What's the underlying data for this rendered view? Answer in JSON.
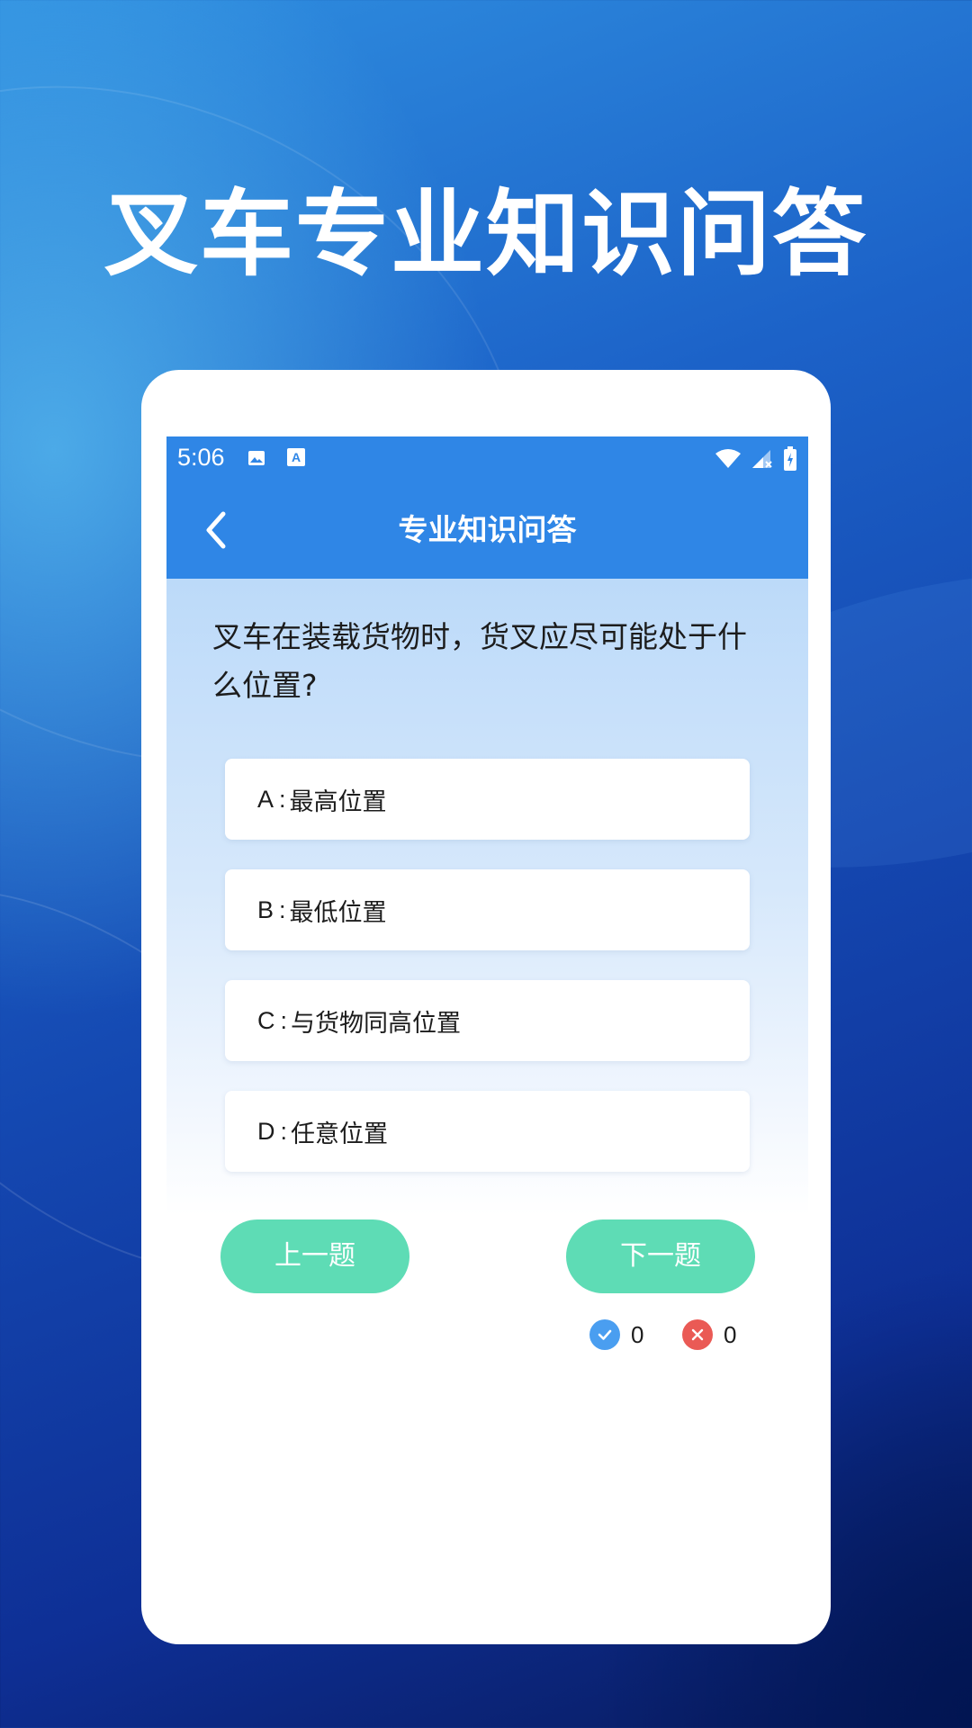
{
  "promo": {
    "headline": "叉车专业知识问答"
  },
  "status_bar": {
    "time": "5:06",
    "icons": [
      "image-icon",
      "text-a-icon",
      "wifi-icon",
      "signal-icon",
      "battery-icon"
    ]
  },
  "app_bar": {
    "title": "专业知识问答",
    "back_icon": "chevron-left-icon"
  },
  "quiz": {
    "question": "叉车在装载货物时，货叉应尽可能处于什么位置?",
    "options": [
      {
        "letter": "A",
        "sep": ":",
        "text": "最高位置"
      },
      {
        "letter": "B",
        "sep": ":",
        "text": "最低位置"
      },
      {
        "letter": "C",
        "sep": ":",
        "text": "与货物同高位置"
      },
      {
        "letter": "D",
        "sep": ":",
        "text": "任意位置"
      }
    ],
    "prev_label": "上一题",
    "next_label": "下一题",
    "correct_count": "0",
    "wrong_count": "0"
  },
  "colors": {
    "app_bar": "#2f86e6",
    "button": "#5edcb5",
    "correct": "#4a9ef0",
    "wrong": "#ea5a55"
  }
}
